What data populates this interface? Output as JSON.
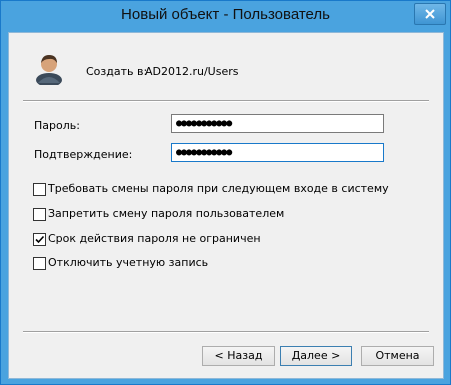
{
  "window": {
    "title": "Новый объект - Пользователь"
  },
  "header": {
    "create_in_label": "Создать в:",
    "create_in_value": "AD2012.ru/Users"
  },
  "fields": {
    "password_label": "Пароль:",
    "password_value": "●●●●●●●●●●●",
    "confirm_label": "Подтверждение:",
    "confirm_value": "●●●●●●●●●●●"
  },
  "options": [
    {
      "label": "Требовать смены пароля при следующем входе в систему",
      "checked": false
    },
    {
      "label": "Запретить смену пароля пользователем",
      "checked": false
    },
    {
      "label": "Срок действия пароля не ограничен",
      "checked": true
    },
    {
      "label": "Отключить учетную запись",
      "checked": false
    }
  ],
  "buttons": {
    "back": "< Назад",
    "next": "Далее >",
    "cancel": "Отмена"
  },
  "colors": {
    "titlebar": "#4aa3df",
    "dialog_bg": "#f0f0f0",
    "focus_border": "#1979ca"
  },
  "icons": {
    "avatar": "user-icon",
    "close": "close-icon",
    "checkmark": "checkmark-icon"
  }
}
